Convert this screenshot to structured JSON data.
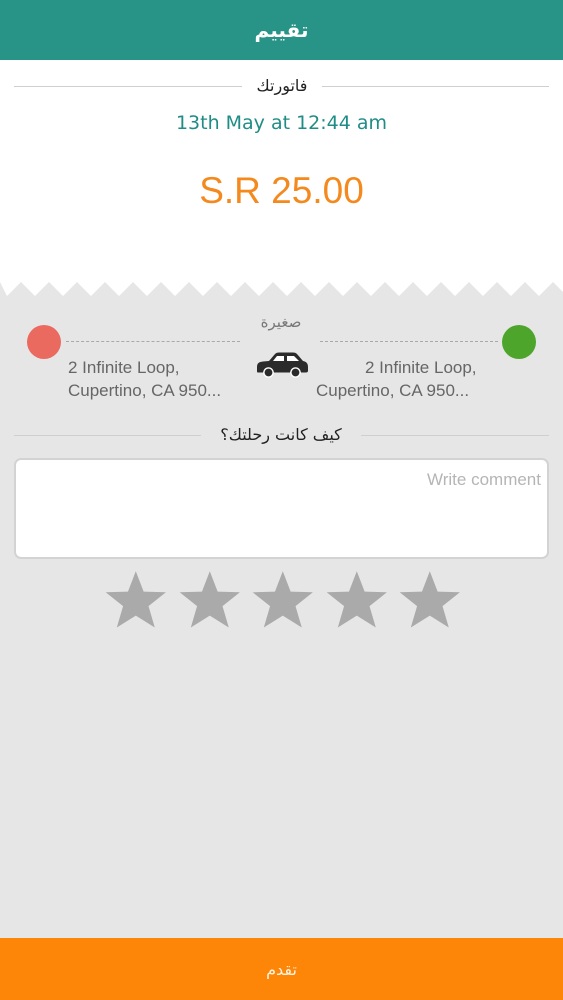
{
  "header": {
    "title": "تقييم"
  },
  "invoice": {
    "title": "فاتورتك",
    "date": "13th May at 12:44 am",
    "amount": "S.R 25.00"
  },
  "trip": {
    "car_type": "صغيرة",
    "car_icon": "car-icon",
    "pickup": {
      "line1": "2 Infinite Loop,",
      "line2": "Cupertino, CA 950..."
    },
    "dropoff": {
      "line1": "2 Infinite Loop,",
      "line2": "Cupertino, CA 950..."
    },
    "colors": {
      "start_dot": "#ea6a5f",
      "end_dot": "#4ea52b"
    }
  },
  "feedback": {
    "question": "كيف كانت رحلتك؟",
    "comment_placeholder": "Write comment",
    "comment_value": "",
    "rating": 0,
    "max_rating": 5
  },
  "footer": {
    "submit_label": "تقدم"
  },
  "colors": {
    "header": "#279487",
    "accent": "#f4891e",
    "submit": "#fd8508",
    "date": "#1f8d86"
  }
}
